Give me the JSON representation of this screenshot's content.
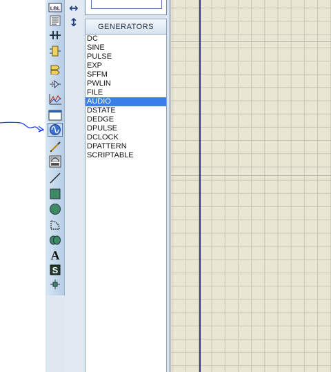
{
  "toolbar": {
    "tools": [
      {
        "name": "label-mode-icon",
        "label": "LBL"
      },
      {
        "name": "text-script-icon"
      },
      {
        "name": "bus-icon"
      },
      {
        "name": "subcircuit-icon"
      },
      {
        "name": "terminal-icon"
      },
      {
        "name": "device-pin-icon"
      },
      {
        "name": "graph-icon"
      },
      {
        "name": "tape-recorder-icon"
      },
      {
        "name": "generator-icon",
        "active": true
      },
      {
        "name": "voltage-probe-icon"
      },
      {
        "name": "virtual-instrument-icon"
      },
      {
        "name": "line-icon"
      },
      {
        "name": "box-icon"
      },
      {
        "name": "circle-icon"
      },
      {
        "name": "arc-icon"
      },
      {
        "name": "path-icon"
      },
      {
        "name": "text-icon",
        "label": "A"
      },
      {
        "name": "symbol-icon",
        "label": "S"
      },
      {
        "name": "marker-icon"
      }
    ]
  },
  "rotation": {
    "tools": [
      {
        "name": "mirror-horizontal-icon",
        "glyph": "↔"
      },
      {
        "name": "mirror-vertical-icon",
        "glyph": "↕"
      }
    ]
  },
  "generators": {
    "header": "GENERATORS",
    "items": [
      "DC",
      "SINE",
      "PULSE",
      "EXP",
      "SFFM",
      "PWLIN",
      "FILE",
      "AUDIO",
      "DSTATE",
      "DEDGE",
      "DPULSE",
      "DCLOCK",
      "DPATTERN",
      "SCRIPTABLE"
    ],
    "selected": "AUDIO"
  },
  "colors": {
    "selection": "#3b7ee8",
    "annotation_ink": "#1a3fe0",
    "sheet_border": "#2a2f9a",
    "canvas": "#e9e6d4"
  }
}
